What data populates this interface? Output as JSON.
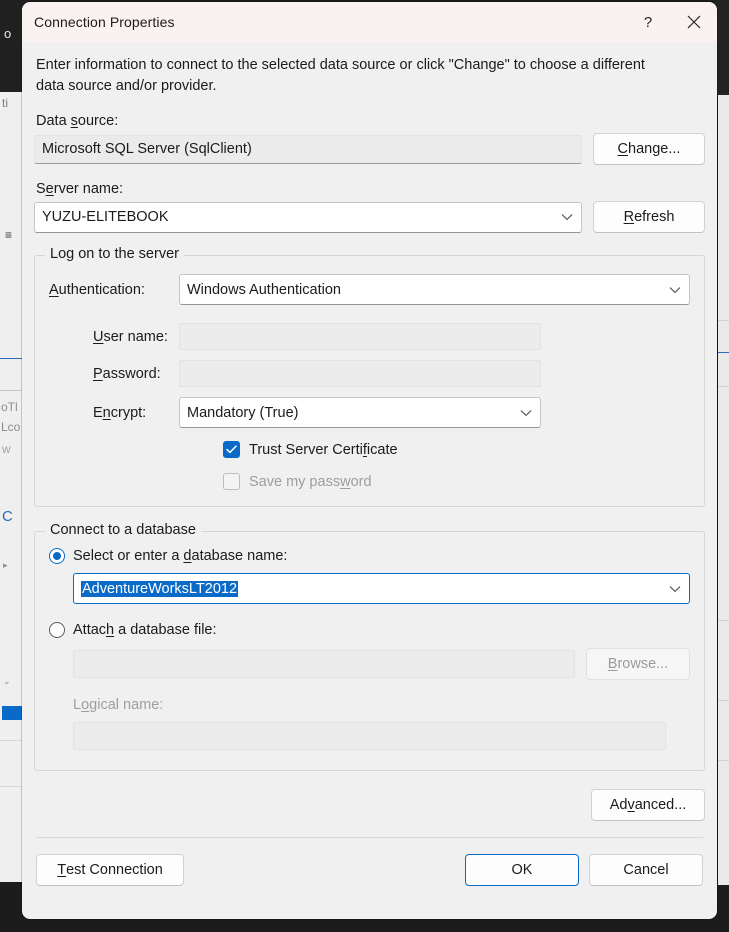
{
  "window": {
    "title": "Connection Properties",
    "help_icon": "question-mark-icon",
    "close_icon": "close-icon"
  },
  "intro": "Enter information to connect to the selected data source or click \"Change\" to choose a different data source and/or provider.",
  "data_source": {
    "label_pre": "Data ",
    "label_accel": "s",
    "label_post": "ource:",
    "value": "Microsoft SQL Server (SqlClient)",
    "change_button": {
      "pre": "",
      "accel": "C",
      "post": "hange..."
    }
  },
  "server_name": {
    "label_pre": "S",
    "label_accel": "e",
    "label_post": "rver name:",
    "value": "YUZU-ELITEBOOK",
    "refresh_button": {
      "pre": "",
      "accel": "R",
      "post": "efresh"
    }
  },
  "logon_group": {
    "legend": "Log on to the server",
    "authentication": {
      "label_pre": "",
      "label_accel": "A",
      "label_post": "uthentication:",
      "value": "Windows Authentication"
    },
    "user_name": {
      "label_pre": "",
      "label_accel": "U",
      "label_post": "ser name:",
      "value": ""
    },
    "password": {
      "label_pre": "",
      "label_accel": "P",
      "label_post": "assword:",
      "value": ""
    },
    "encrypt": {
      "label_pre": "E",
      "label_accel": "n",
      "label_post": "crypt:",
      "value": "Mandatory (True)"
    },
    "trust_server_certificate": {
      "label_pre": "Trust Server Certi",
      "label_accel": "f",
      "label_post": "icate",
      "checked": true,
      "enabled": true
    },
    "save_my_password": {
      "label_pre": "Save my pass",
      "label_accel": "w",
      "label_post": "ord",
      "checked": false,
      "enabled": false
    }
  },
  "database_group": {
    "legend": "Connect to a database",
    "select_database": {
      "label_pre": "Select or enter a ",
      "label_accel": "d",
      "label_post": "atabase name:",
      "selected": true,
      "value": "AdventureWorksLT2012",
      "value_selected": true
    },
    "attach_file": {
      "label_pre": "Attac",
      "label_accel": "h",
      "label_post": " a database file:",
      "selected": false,
      "value": "",
      "browse_button": {
        "pre": "",
        "accel": "B",
        "post": "rowse..."
      }
    },
    "logical_name": {
      "label_pre": "L",
      "label_accel": "o",
      "label_post": "gical name:",
      "value": "",
      "enabled": false
    }
  },
  "advanced_button": {
    "pre": "Ad",
    "accel": "v",
    "post": "anced..."
  },
  "footer": {
    "test_connection": {
      "pre": "",
      "accel": "T",
      "post": "est Connection"
    },
    "ok": "OK",
    "cancel": "Cancel"
  },
  "colors": {
    "accent": "#0a6ac8",
    "dialog_bg": "#f0f0f0",
    "titlebar_bg": "#faf2f1",
    "text": "#1b1b1b",
    "disabled_text": "#9e9e9e"
  }
}
